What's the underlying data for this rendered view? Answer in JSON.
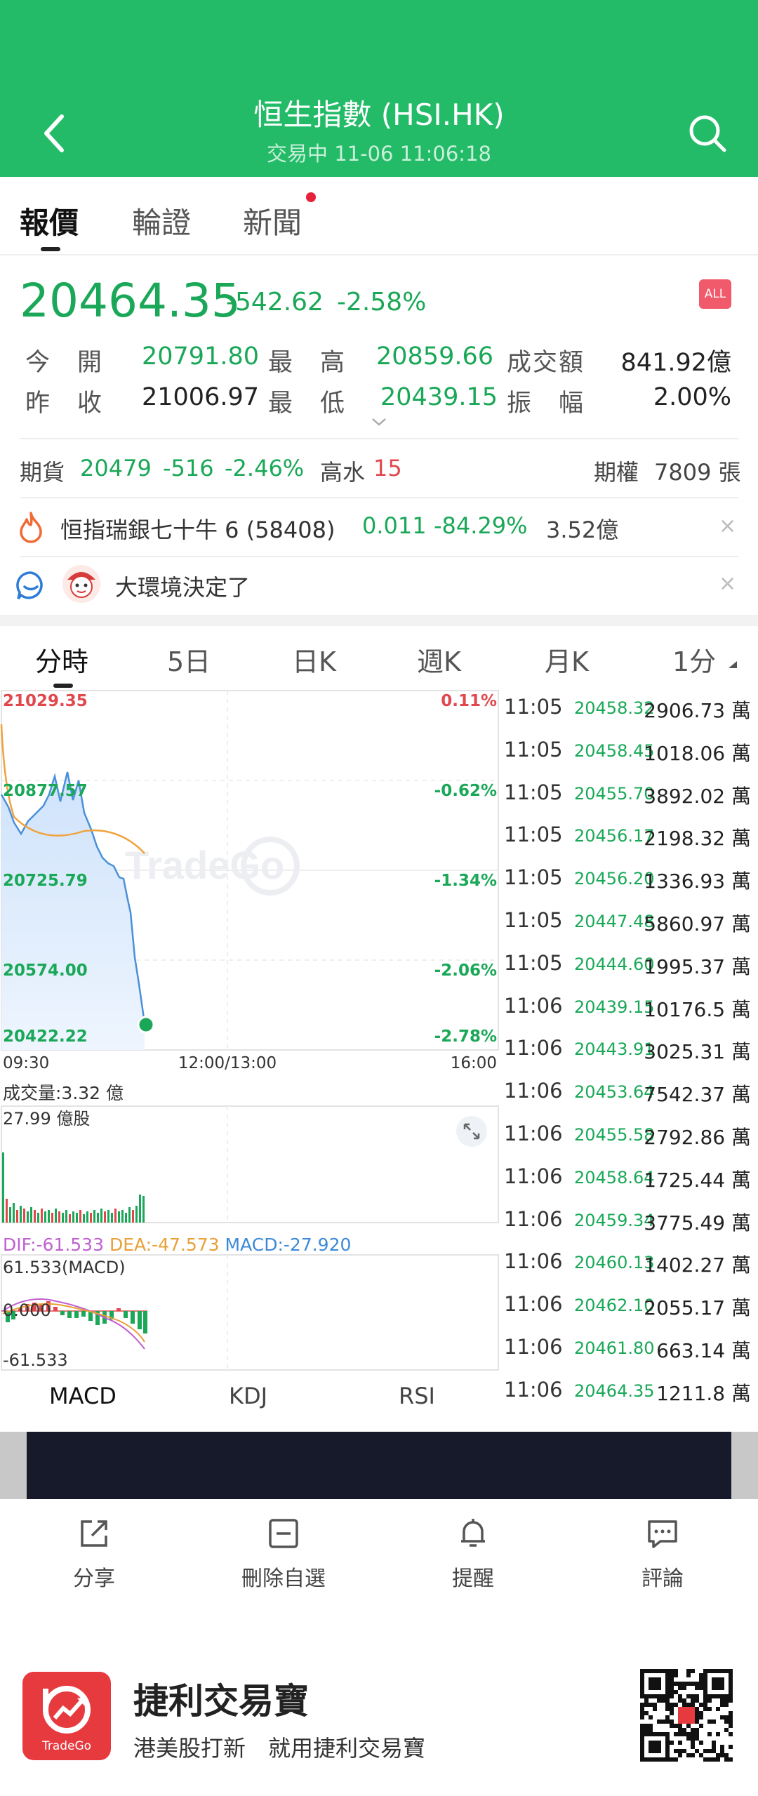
{
  "header": {
    "title": "恒生指數 (HSI.HK)",
    "subtitle": "交易中 11-06 11:06:18",
    "bg_color": "#24bb68"
  },
  "tabs": [
    "報價",
    "輪證",
    "新聞"
  ],
  "quote": {
    "price": "20464.35",
    "change": "-542.62",
    "change_pct": "-2.58%",
    "badge": "ALL"
  },
  "stats": {
    "open_label": "今　開",
    "open": "20791.80",
    "high_label": "最　高",
    "high": "20859.66",
    "turnover_label": "成交額",
    "turnover": "841.92億",
    "prev_label": "昨　收",
    "prev": "21006.97",
    "low_label": "最　低",
    "low": "20439.15",
    "amp_label": "振　幅",
    "amp": "2.00%"
  },
  "futures": {
    "label": "期貨",
    "price": "20479",
    "change": "-516",
    "pct": "-2.46%",
    "premium_label": "高水",
    "premium": "15",
    "options_label": "期權",
    "options": "7809 張"
  },
  "hot_warrant": {
    "name": "恒指瑞銀七十牛 6 (58408)",
    "price": "0.011",
    "pct": "-84.29%",
    "amount": "3.52億"
  },
  "comment": {
    "text": "大環境決定了"
  },
  "chart_tabs": [
    "分時",
    "5日",
    "日K",
    "週K",
    "月K",
    "1分"
  ],
  "chart": {
    "y_labels": [
      "21029.35",
      "20877.57",
      "20725.79",
      "20574.00",
      "20422.22"
    ],
    "pct_labels": [
      "0.11%",
      "-0.62%",
      "-1.34%",
      "-2.06%",
      "-2.78%"
    ],
    "x_labels": [
      "09:30",
      "12:00/13:00",
      "16:00"
    ],
    "volume_label": "成交量:3.32 億",
    "volume_max": "27.99 億股",
    "dif": "DIF:-61.533",
    "dea": "DEA:-47.573",
    "macd": "MACD:-27.920",
    "macd_max": "61.533(MACD)",
    "macd_zero": "0.000",
    "macd_min": "-61.533",
    "watermark": "TradeGo"
  },
  "indicator_tabs": [
    "MACD",
    "KDJ",
    "RSI"
  ],
  "trades": [
    {
      "time": "11:05",
      "price": "20458.32",
      "vol": "2906.73 萬"
    },
    {
      "time": "11:05",
      "price": "20458.45",
      "vol": "1018.06 萬"
    },
    {
      "time": "11:05",
      "price": "20455.70",
      "vol": "3892.02 萬"
    },
    {
      "time": "11:05",
      "price": "20456.17",
      "vol": "2198.32 萬"
    },
    {
      "time": "11:05",
      "price": "20456.20",
      "vol": "1336.93 萬"
    },
    {
      "time": "11:05",
      "price": "20447.48",
      "vol": "5860.97 萬"
    },
    {
      "time": "11:05",
      "price": "20444.60",
      "vol": "1995.37 萬"
    },
    {
      "time": "11:06",
      "price": "20439.15",
      "vol": "10176.5 萬"
    },
    {
      "time": "11:06",
      "price": "20443.91",
      "vol": "3025.31 萬"
    },
    {
      "time": "11:06",
      "price": "20453.64",
      "vol": "7542.37 萬"
    },
    {
      "time": "11:06",
      "price": "20455.58",
      "vol": "2792.86 萬"
    },
    {
      "time": "11:06",
      "price": "20458.64",
      "vol": "1725.44 萬"
    },
    {
      "time": "11:06",
      "price": "20459.34",
      "vol": "3775.49 萬"
    },
    {
      "time": "11:06",
      "price": "20460.13",
      "vol": "1402.27 萬"
    },
    {
      "time": "11:06",
      "price": "20462.10",
      "vol": "2055.17 萬"
    },
    {
      "time": "11:06",
      "price": "20461.80",
      "vol": "663.14 萬"
    },
    {
      "time": "11:06",
      "price": "20464.35",
      "vol": "1211.8 萬"
    }
  ],
  "actions": [
    "分享",
    "刪除自選",
    "提醒",
    "評論"
  ],
  "promo": {
    "title": "捷利交易寶",
    "subtitle": "港美股打新　就用捷利交易寶",
    "logo_text": "TradeGo"
  }
}
